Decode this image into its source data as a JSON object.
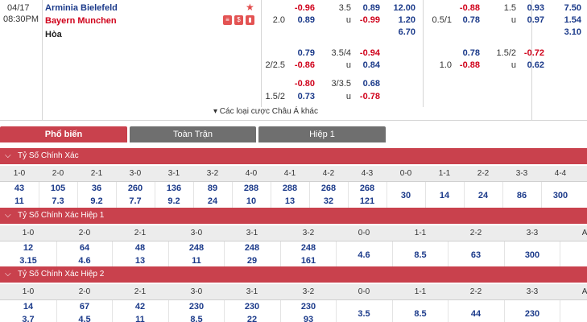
{
  "match": {
    "date": "04/17",
    "time": "08:30PM",
    "home_team": "Arminia Bielefeld",
    "away_team": "Bayern Munchen",
    "draw_label": "Hòa",
    "icons": [
      "star-icon",
      "list-icon",
      "dollar-icon",
      "stats-icon"
    ]
  },
  "odds_block1": [
    {
      "hdp_label": "",
      "hdp_odds": "-0.96",
      "ou_label": "3.5",
      "ou_odds": "0.89",
      "x12": "12.00"
    },
    {
      "hdp_label": "2.0",
      "hdp_odds": "0.89",
      "ou_label": "u",
      "ou_odds": "-0.99",
      "x12": "1.20"
    },
    {
      "hdp_label": "",
      "hdp_odds": "",
      "ou_label": "",
      "ou_odds": "",
      "x12": "6.70"
    },
    {
      "hdp_label": "",
      "hdp_odds": "0.79",
      "ou_label": "3.5/4",
      "ou_odds": "-0.94",
      "x12": ""
    },
    {
      "hdp_label": "2/2.5",
      "hdp_odds": "-0.86",
      "ou_label": "u",
      "ou_odds": "0.84",
      "x12": ""
    },
    {
      "hdp_label": "",
      "hdp_odds": "-0.80",
      "ou_label": "3/3.5",
      "ou_odds": "0.68",
      "x12": ""
    },
    {
      "hdp_label": "1.5/2",
      "hdp_odds": "0.73",
      "ou_label": "u",
      "ou_odds": "-0.78",
      "x12": ""
    }
  ],
  "odds_block2": [
    {
      "hdp_label": "",
      "hdp_odds": "-0.88",
      "ou_label": "1.5",
      "ou_odds": "0.93",
      "x12": "7.50"
    },
    {
      "hdp_label": "0.5/1",
      "hdp_odds": "0.78",
      "ou_label": "u",
      "ou_odds": "0.97",
      "x12": "1.54"
    },
    {
      "hdp_label": "",
      "hdp_odds": "",
      "ou_label": "",
      "ou_odds": "",
      "x12": "3.10"
    },
    {
      "hdp_label": "",
      "hdp_odds": "0.78",
      "ou_label": "1.5/2",
      "ou_odds": "-0.72",
      "x12": ""
    },
    {
      "hdp_label": "1.0",
      "hdp_odds": "-0.88",
      "ou_label": "u",
      "ou_odds": "0.62",
      "x12": ""
    }
  ],
  "more_asian": "Các loại cược Châu Á khác",
  "tabs": [
    "Phổ biến",
    "Toàn Trận",
    "Hiệp 1"
  ],
  "sections": [
    {
      "title": "Tỷ Số Chính Xác",
      "scores": [
        "1-0",
        "2-0",
        "2-1",
        "3-0",
        "3-1",
        "3-2",
        "4-0",
        "4-1",
        "4-2",
        "4-3",
        "0-0",
        "1-1",
        "2-2",
        "3-3",
        "4-4"
      ],
      "home": [
        "43",
        "105",
        "36",
        "260",
        "136",
        "89",
        "288",
        "288",
        "268",
        "268",
        "30",
        "14",
        "24",
        "86",
        "300"
      ],
      "away": [
        "11",
        "7.3",
        "9.2",
        "7.7",
        "9.2",
        "24",
        "10",
        "13",
        "32",
        "121",
        "",
        "",
        "",
        "",
        ""
      ]
    },
    {
      "title": "Tỷ Số Chính Xác Hiệp 1",
      "scores": [
        "1-0",
        "2-0",
        "2-1",
        "3-0",
        "3-1",
        "3-2",
        "0-0",
        "1-1",
        "2-2",
        "3-3",
        "AO"
      ],
      "home": [
        "12",
        "64",
        "48",
        "248",
        "248",
        "248",
        "4.6",
        "8.5",
        "63",
        "300",
        ""
      ],
      "away": [
        "3.15",
        "4.6",
        "13",
        "11",
        "29",
        "161",
        "",
        "",
        "",
        "",
        ""
      ]
    },
    {
      "title": "Tỷ Số Chính Xác Hiệp 2",
      "scores": [
        "1-0",
        "2-0",
        "2-1",
        "3-0",
        "3-1",
        "3-2",
        "0-0",
        "1-1",
        "2-2",
        "3-3",
        "AO"
      ],
      "home": [
        "14",
        "67",
        "42",
        "230",
        "230",
        "230",
        "3.5",
        "8.5",
        "44",
        "230",
        ""
      ],
      "away": [
        "3.7",
        "4.5",
        "11",
        "8.5",
        "22",
        "93",
        "",
        "",
        "",
        "",
        ""
      ]
    }
  ]
}
